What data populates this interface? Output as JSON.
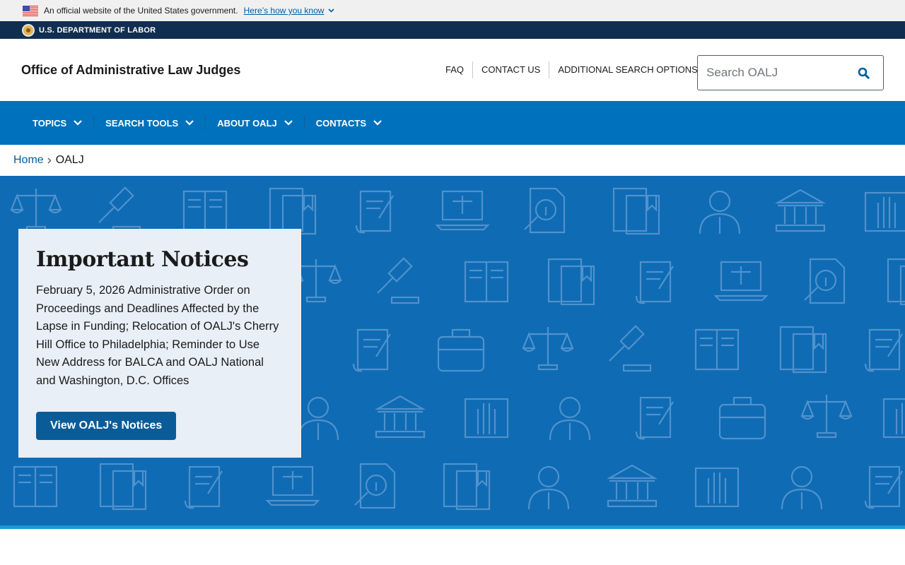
{
  "gov_banner": {
    "text": "An official website of the United States government.",
    "link": "Here’s how you know"
  },
  "dept": {
    "name": "U.S. DEPARTMENT OF LABOR"
  },
  "header": {
    "site_title": "Office of Administrative Law Judges",
    "utility_links": [
      "FAQ",
      "CONTACT US",
      "ADDITIONAL SEARCH OPTIONS"
    ],
    "search_placeholder": "Search OALJ"
  },
  "main_nav": {
    "items": [
      "TOPICS",
      "SEARCH TOOLS",
      "ABOUT OALJ",
      "CONTACTS"
    ]
  },
  "breadcrumb": {
    "home": "Home",
    "current": "OALJ"
  },
  "notice": {
    "title": "Important Notices",
    "body": "February 5, 2026 Administrative Order on Proceedings and Deadlines Affected by the Lapse in Funding; Relocation of OALJ's Cherry Hill Office to Philadelphia; Reminder to Use New Address for BALCA and OALJ National and Washington, D.C. Offices",
    "button": "View OALJ's Notices"
  },
  "colors": {
    "nav_blue": "#0071bc",
    "hero_blue": "#0f6bb4",
    "dept_navy": "#112e51",
    "link_blue": "#005ea2"
  }
}
